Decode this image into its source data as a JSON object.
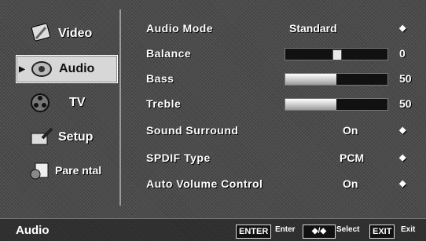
{
  "sidebar": {
    "items": [
      {
        "label": "Video",
        "icon": "video-icon"
      },
      {
        "label": "Audio",
        "icon": "audio-icon",
        "selected": true
      },
      {
        "label": "TV",
        "icon": "tv-reel-icon"
      },
      {
        "label": "Setup",
        "icon": "setup-icon"
      },
      {
        "label": "Pare ntal",
        "icon": "parental-icon"
      }
    ]
  },
  "settings": {
    "audio_mode": {
      "label": "Audio Mode",
      "value": "Standard"
    },
    "balance": {
      "label": "Balance",
      "value": "0",
      "level": 0.5
    },
    "bass": {
      "label": "Bass",
      "value": "50",
      "level": 0.5
    },
    "treble": {
      "label": "Treble",
      "value": "50",
      "level": 0.5
    },
    "sound_surround": {
      "label": "Sound Surround",
      "value": "On"
    },
    "spdif_type": {
      "label": "SPDIF Type",
      "value": "PCM"
    },
    "auto_volume": {
      "label": "Auto Volume Control",
      "value": "On"
    }
  },
  "footer": {
    "title": "Audio",
    "enter_key": "ENTER",
    "enter_hint": "Enter",
    "select_hint": "Select",
    "exit_key": "EXIT",
    "exit_hint": "Exit"
  },
  "colors": {
    "selected_bg": "#d7d7d7",
    "text": "#ffffff"
  }
}
